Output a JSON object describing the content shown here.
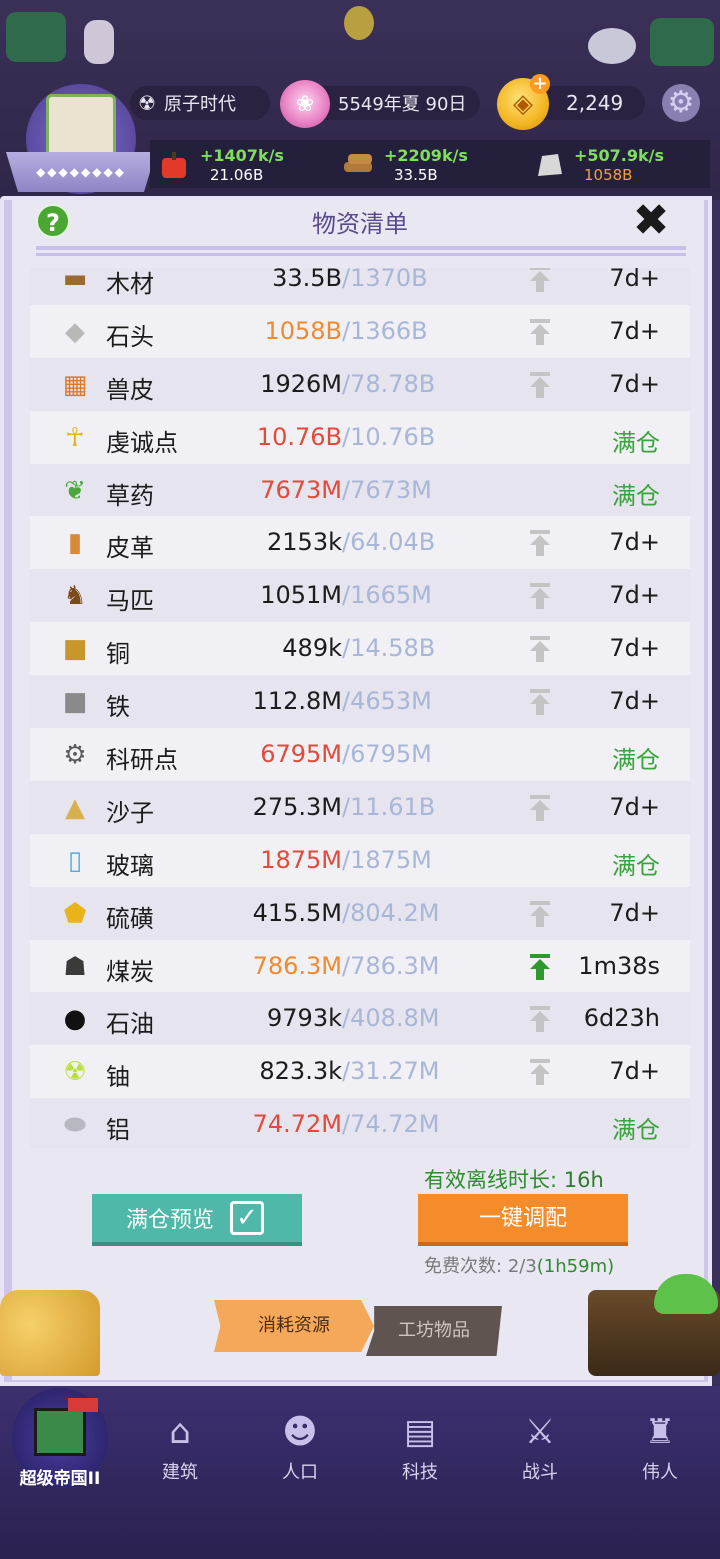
{
  "topbar": {
    "era": "原子时代",
    "date": "5549年夏 90日",
    "gold": "2,249",
    "emblem_label": "◆◆◆◆◆◆◆◆"
  },
  "rates": [
    {
      "amount": "+1407k/s",
      "total": "21.06B",
      "icon": "apple-icon"
    },
    {
      "amount": "+2209k/s",
      "total": "33.5B",
      "icon": "wood-icon"
    },
    {
      "amount": "+507.9k/s",
      "total": "1058B",
      "icon": "stone-icon"
    }
  ],
  "panel": {
    "title": "物资清单",
    "help": "?",
    "close": "✖"
  },
  "resources": [
    {
      "name": "木材",
      "value": "33.5B",
      "cap": "/1370B",
      "status": "7d+",
      "value_color": "normal",
      "full": false,
      "arrow": "grey",
      "icon": "wood-icon"
    },
    {
      "name": "石头",
      "value": "1058B",
      "cap": "/1366B",
      "status": "7d+",
      "value_color": "orange",
      "full": false,
      "arrow": "grey",
      "icon": "stone-icon"
    },
    {
      "name": "兽皮",
      "value": "1926M",
      "cap": "/78.78B",
      "status": "7d+",
      "value_color": "normal",
      "full": false,
      "arrow": "grey",
      "icon": "hide-icon"
    },
    {
      "name": "虔诚点",
      "value": "10.76B",
      "cap": "/10.76B",
      "status": "满仓",
      "value_color": "red",
      "full": true,
      "arrow": "none",
      "icon": "ankh-icon"
    },
    {
      "name": "草药",
      "value": "7673M",
      "cap": "/7673M",
      "status": "满仓",
      "value_color": "red",
      "full": true,
      "arrow": "none",
      "icon": "herb-icon"
    },
    {
      "name": "皮革",
      "value": "2153k",
      "cap": "/64.04B",
      "status": "7d+",
      "value_color": "normal",
      "full": false,
      "arrow": "grey",
      "icon": "leather-icon"
    },
    {
      "name": "马匹",
      "value": "1051M",
      "cap": "/1665M",
      "status": "7d+",
      "value_color": "normal",
      "full": false,
      "arrow": "grey",
      "icon": "horse-icon"
    },
    {
      "name": "铜",
      "value": "489k",
      "cap": "/14.58B",
      "status": "7d+",
      "value_color": "normal",
      "full": false,
      "arrow": "grey",
      "icon": "copper-icon"
    },
    {
      "name": "铁",
      "value": "112.8M",
      "cap": "/4653M",
      "status": "7d+",
      "value_color": "normal",
      "full": false,
      "arrow": "grey",
      "icon": "iron-icon"
    },
    {
      "name": "科研点",
      "value": "6795M",
      "cap": "/6795M",
      "status": "满仓",
      "value_color": "red",
      "full": true,
      "arrow": "none",
      "icon": "gears-icon"
    },
    {
      "name": "沙子",
      "value": "275.3M",
      "cap": "/11.61B",
      "status": "7d+",
      "value_color": "normal",
      "full": false,
      "arrow": "grey",
      "icon": "sand-icon"
    },
    {
      "name": "玻璃",
      "value": "1875M",
      "cap": "/1875M",
      "status": "满仓",
      "value_color": "red",
      "full": true,
      "arrow": "none",
      "icon": "glass-icon"
    },
    {
      "name": "硫磺",
      "value": "415.5M",
      "cap": "/804.2M",
      "status": "7d+",
      "value_color": "normal",
      "full": false,
      "arrow": "grey",
      "icon": "sulfur-icon"
    },
    {
      "name": "煤炭",
      "value": "786.3M",
      "cap": "/786.3M",
      "status": "1m38s",
      "value_color": "orange",
      "full": false,
      "arrow": "green",
      "icon": "coal-icon"
    },
    {
      "name": "石油",
      "value": "9793k",
      "cap": "/408.8M",
      "status": "6d23h",
      "value_color": "normal",
      "full": false,
      "arrow": "grey",
      "icon": "oil-icon"
    },
    {
      "name": "铀",
      "value": "823.3k",
      "cap": "/31.27M",
      "status": "7d+",
      "value_color": "normal",
      "full": false,
      "arrow": "grey",
      "icon": "uranium-icon"
    },
    {
      "name": "铝",
      "value": "74.72M",
      "cap": "/74.72M",
      "status": "满仓",
      "value_color": "red",
      "full": true,
      "arrow": "none",
      "icon": "aluminum-icon"
    }
  ],
  "footer": {
    "offline_label": "有效离线时长:",
    "offline_value": "16h",
    "preview_button": "满仓预览",
    "alloc_button": "一键调配",
    "free_label": "免费次数:",
    "free_value": "2/3",
    "free_timer": "(1h59m)"
  },
  "tabs": {
    "consume": "消耗资源",
    "workshop": "工坊物品"
  },
  "nav": [
    {
      "label": "超级帝国II",
      "icon": "castle-icon"
    },
    {
      "label": "建筑",
      "icon": "house-icon"
    },
    {
      "label": "人口",
      "icon": "person-icon"
    },
    {
      "label": "科技",
      "icon": "book-icon"
    },
    {
      "label": "战斗",
      "icon": "swords-icon"
    },
    {
      "label": "伟人",
      "icon": "statue-icon"
    }
  ],
  "colors": {
    "red": "#e24a3a",
    "orange": "#f08a30",
    "green": "#3aa33a",
    "cap_blue": "#a8b6d8"
  }
}
